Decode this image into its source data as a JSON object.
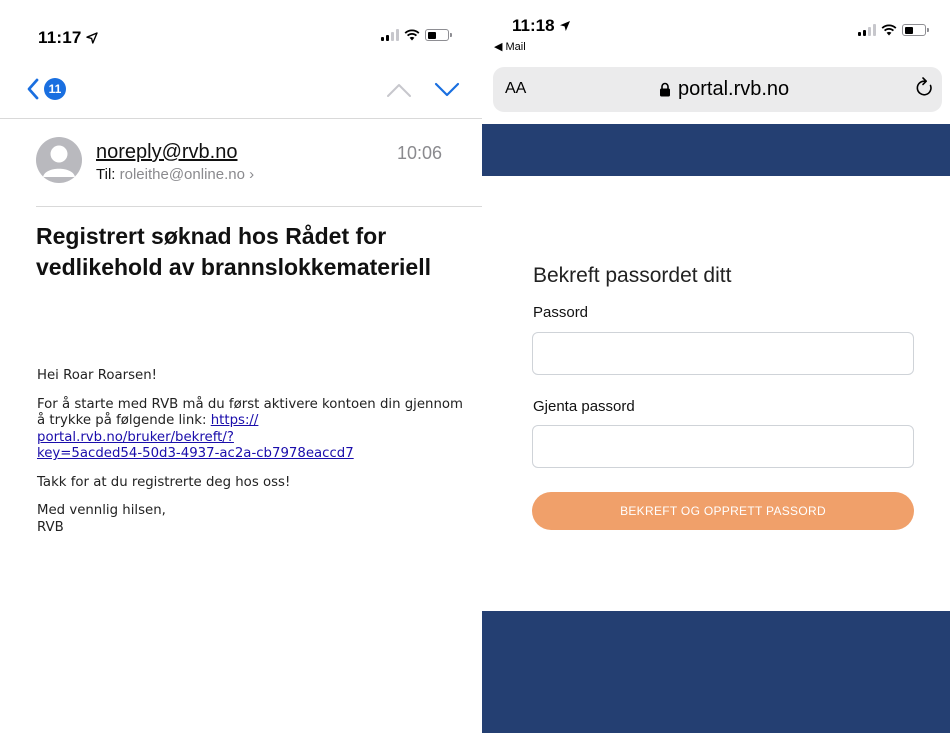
{
  "mail": {
    "status_time": "11:17",
    "unread_badge": "11",
    "sender": "noreply@rvb.no",
    "received_time": "10:06",
    "to_label": "Til:",
    "to_address": "roleithe@online.no",
    "subject": "Registrert søknad hos Rådet for vedlikehold av brannslokkemateriell",
    "greeting": "Hei Roar Roarsen!",
    "instruction": "For å starte med RVB må du først aktivere kontoen din gjennom å trykke på følgende link: ",
    "link": "https://portal.rvb.no/bruker/bekreft/?key=5acded54-50d3-4937-ac2a-cb7978eaccd7",
    "link_display_lines": [
      "https://",
      "portal.rvb.no/bruker/bekreft/?",
      "key=5acded54-50d3-4937-ac2a-cb7978eaccd7"
    ],
    "thanks": "Takk for at du registrerte deg hos oss!",
    "signoff": "Med vennlig hilsen,",
    "signature": "RVB"
  },
  "browser": {
    "status_time": "11:18",
    "back_app": "◀ Mail",
    "text_size_label": "AA",
    "url": "portal.rvb.no",
    "accent_navy": "#243f72",
    "form": {
      "heading": "Bekreft passordet ditt",
      "password_label": "Passord",
      "password_value": "",
      "repeat_label": "Gjenta passord",
      "repeat_value": "",
      "submit_label": "BEKREFT OG OPPRETT PASSORD",
      "submit_color": "#f0a06a"
    }
  }
}
